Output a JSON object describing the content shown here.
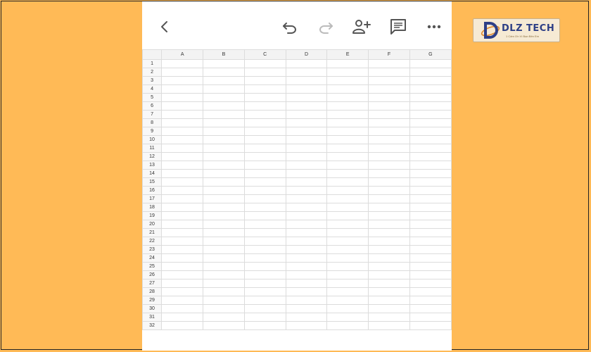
{
  "toolbar": {
    "back_icon": "chevron-left-icon",
    "undo_icon": "undo-icon",
    "redo_icon": "redo-icon",
    "share_icon": "add-person-icon",
    "comment_icon": "comment-icon",
    "more_icon": "more-horizontal-icon"
  },
  "sheet": {
    "columns": [
      "A",
      "B",
      "C",
      "D",
      "E",
      "F",
      "G"
    ],
    "rows": [
      "1",
      "2",
      "3",
      "4",
      "5",
      "6",
      "7",
      "8",
      "9",
      "10",
      "11",
      "12",
      "13",
      "14",
      "15",
      "16",
      "17",
      "18",
      "19",
      "20",
      "21",
      "22",
      "23",
      "24",
      "25",
      "26",
      "27",
      "28",
      "29",
      "30",
      "31",
      "32"
    ]
  },
  "logo": {
    "text": "DLZ TECH",
    "tagline": "1 Cảm Ơn Vì Bạn Bên Em",
    "primary_color": "#2e3f86",
    "accent_color": "#e08a2c"
  },
  "colors": {
    "background": "#ffba56"
  }
}
